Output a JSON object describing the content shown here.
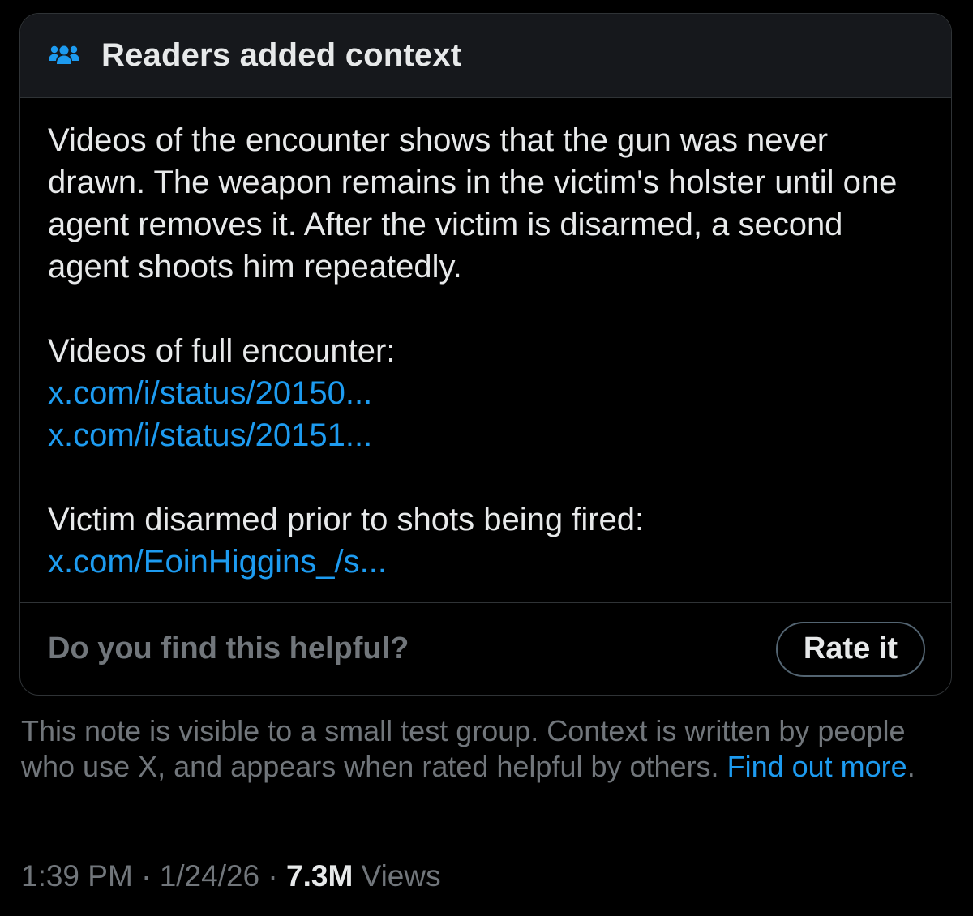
{
  "note": {
    "header_title": "Readers added context",
    "header_icon": "people-icon",
    "paragraph_1": "Videos of the encounter shows that the gun was never drawn. The weapon remains in the victim's holster until one agent removes it. After the victim is disarmed, a second agent shoots him repeatedly.",
    "paragraph_2": "Videos of full encounter:",
    "links_group_1": [
      "x.com/i/status/20150...",
      "x.com/i/status/20151..."
    ],
    "paragraph_3": "Victim disarmed prior to shots being fired:",
    "links_group_2": [
      "x.com/EoinHiggins_/s..."
    ],
    "helpful_question": "Do you find this helpful?",
    "rate_button_label": "Rate it"
  },
  "disclaimer": {
    "text": "This note is visible to a small test group. Context is written by people who use X, and appears when rated helpful by others.",
    "link_text": "Find out more",
    "trailing": "."
  },
  "meta": {
    "time": "1:39 PM",
    "separator": " · ",
    "date": "1/24/26",
    "views_count": "7.3M",
    "views_label": " Views"
  },
  "colors": {
    "background": "#000000",
    "header_bg": "#16181c",
    "link": "#1d9bf0",
    "text": "#e7e9ea",
    "muted": "#71767b",
    "border": "#2f3336"
  }
}
